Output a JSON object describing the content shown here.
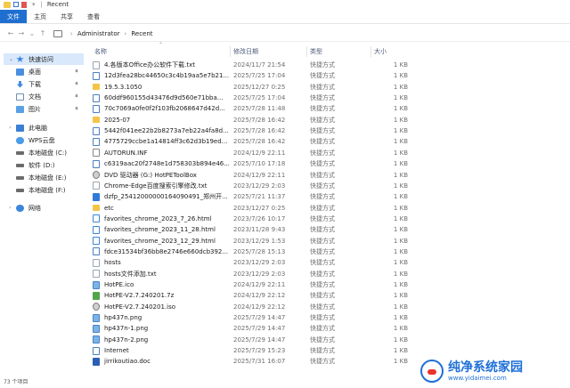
{
  "window": {
    "title": "Recent"
  },
  "ribbon": {
    "tabs": [
      "文件",
      "主页",
      "共享",
      "查看"
    ]
  },
  "address": {
    "path": [
      "Administrator",
      "Recent"
    ]
  },
  "columns": {
    "name": "名称",
    "date": "修改日期",
    "type": "类型",
    "size": "大小"
  },
  "sidebar": {
    "items": [
      {
        "label": "快速访问",
        "icon": "star-icon",
        "selected": true
      },
      {
        "label": "桌面",
        "icon": "desktop-icon",
        "pinned": true
      },
      {
        "label": "下载",
        "icon": "download-icon",
        "pinned": true
      },
      {
        "label": "文档",
        "icon": "documents-icon",
        "pinned": true
      },
      {
        "label": "图片",
        "icon": "pictures-icon",
        "pinned": true
      },
      {
        "label": "此电脑",
        "icon": "computer-icon"
      },
      {
        "label": "WPS云盘",
        "icon": "cloud-icon"
      },
      {
        "label": "本地磁盘 (C:)",
        "icon": "drive-icon"
      },
      {
        "label": "软件 (D:)",
        "icon": "drive-icon"
      },
      {
        "label": "本地磁盘 (E:)",
        "icon": "drive-icon"
      },
      {
        "label": "本地磁盘 (F:)",
        "icon": "drive-icon"
      },
      {
        "label": "网络",
        "icon": "network-icon"
      }
    ]
  },
  "files": [
    {
      "name": "4.各版本Office办公软件下载.txt",
      "date": "2024/11/7 21:54",
      "type": "快捷方式",
      "size": "1 KB",
      "icon": "text"
    },
    {
      "name": "12d3fea28bc44650c3c4b19aa5e7b21...",
      "date": "2025/7/25 17:04",
      "type": "快捷方式",
      "size": "1 KB",
      "icon": "link"
    },
    {
      "name": "19.5.3.1050",
      "date": "2025/12/27 0:25",
      "type": "快捷方式",
      "size": "1 KB",
      "icon": "folder"
    },
    {
      "name": "60ddf960155d43476d9d560e71bba...",
      "date": "2025/7/25 17:04",
      "type": "快捷方式",
      "size": "1 KB",
      "icon": "link"
    },
    {
      "name": "70c7069a0fe0f2f103fb2068647d42d...",
      "date": "2025/7/28 11:48",
      "type": "快捷方式",
      "size": "1 KB",
      "icon": "link"
    },
    {
      "name": "2025-07",
      "date": "2025/7/28 16:42",
      "type": "快捷方式",
      "size": "1 KB",
      "icon": "folder"
    },
    {
      "name": "5442f041ee22b2b8273a7eb22a4fa8d...",
      "date": "2025/7/28 16:42",
      "type": "快捷方式",
      "size": "1 KB",
      "icon": "link"
    },
    {
      "name": "4775729ccbe1a14814ff3c62d3b19ed...",
      "date": "2025/7/28 16:42",
      "type": "快捷方式",
      "size": "1 KB",
      "icon": "link"
    },
    {
      "name": "AUTORUN.INF",
      "date": "2024/12/9 22:11",
      "type": "快捷方式",
      "size": "1 KB",
      "icon": "ini"
    },
    {
      "name": "c6319aac20f2748e1d758303b894e46...",
      "date": "2025/7/10 17:18",
      "type": "快捷方式",
      "size": "1 KB",
      "icon": "link"
    },
    {
      "name": "DVD 驱动器 (G:) HotPEToolBox",
      "date": "2024/12/9 22:11",
      "type": "快捷方式",
      "size": "1 KB",
      "icon": "disc"
    },
    {
      "name": "Chrome-Edge百度搜索引擎修改.txt",
      "date": "2023/12/29 2:03",
      "type": "快捷方式",
      "size": "1 KB",
      "icon": "text"
    },
    {
      "name": "dzfp_25412000000164090491_郑州开...",
      "date": "2025/7/21 11:37",
      "type": "快捷方式",
      "size": "1 KB",
      "icon": "app"
    },
    {
      "name": "etc",
      "date": "2023/12/27 0:25",
      "type": "快捷方式",
      "size": "1 KB",
      "icon": "folder"
    },
    {
      "name": "favorites_chrome_2023_7_26.html",
      "date": "2023/7/26 10:17",
      "type": "快捷方式",
      "size": "1 KB",
      "icon": "html"
    },
    {
      "name": "favorites_chrome_2023_11_28.html",
      "date": "2023/11/28 9:43",
      "type": "快捷方式",
      "size": "1 KB",
      "icon": "html"
    },
    {
      "name": "favorites_chrome_2023_12_29.html",
      "date": "2023/12/29 1:53",
      "type": "快捷方式",
      "size": "1 KB",
      "icon": "html"
    },
    {
      "name": "fdce31534bf36bb8e2746e660dcb392...",
      "date": "2025/7/28 15:13",
      "type": "快捷方式",
      "size": "1 KB",
      "icon": "link"
    },
    {
      "name": "hosts",
      "date": "2023/12/29 2:03",
      "type": "快捷方式",
      "size": "1 KB",
      "icon": "text"
    },
    {
      "name": "hosts文件添加.txt",
      "date": "2023/12/29 2:03",
      "type": "快捷方式",
      "size": "1 KB",
      "icon": "text"
    },
    {
      "name": "HotPE.ico",
      "date": "2024/12/9 22:11",
      "type": "快捷方式",
      "size": "1 KB",
      "icon": "img"
    },
    {
      "name": "HotPE-V2.7.240201.7z",
      "date": "2024/12/9 22:12",
      "type": "快捷方式",
      "size": "1 KB",
      "icon": "zip"
    },
    {
      "name": "HotPE-V2.7.240201.iso",
      "date": "2024/12/9 22:12",
      "type": "快捷方式",
      "size": "1 KB",
      "icon": "disc"
    },
    {
      "name": "hp437n.png",
      "date": "2025/7/29 14:47",
      "type": "快捷方式",
      "size": "1 KB",
      "icon": "img"
    },
    {
      "name": "hp437n-1.png",
      "date": "2025/7/29 14:47",
      "type": "快捷方式",
      "size": "1 KB",
      "icon": "img"
    },
    {
      "name": "hp437n-2.png",
      "date": "2025/7/29 14:47",
      "type": "快捷方式",
      "size": "1 KB",
      "icon": "img"
    },
    {
      "name": "Internet",
      "date": "2025/7/29 15:23",
      "type": "快捷方式",
      "size": "1 KB",
      "icon": "link"
    },
    {
      "name": "jirrikoutiao.doc",
      "date": "2025/7/31 16:07",
      "type": "快捷方式",
      "size": "1 KB",
      "icon": "doc"
    }
  ],
  "status": {
    "count": "73 个项目"
  },
  "watermark": {
    "title": "纯净系统家园",
    "url": "www.yidaimei.com"
  }
}
